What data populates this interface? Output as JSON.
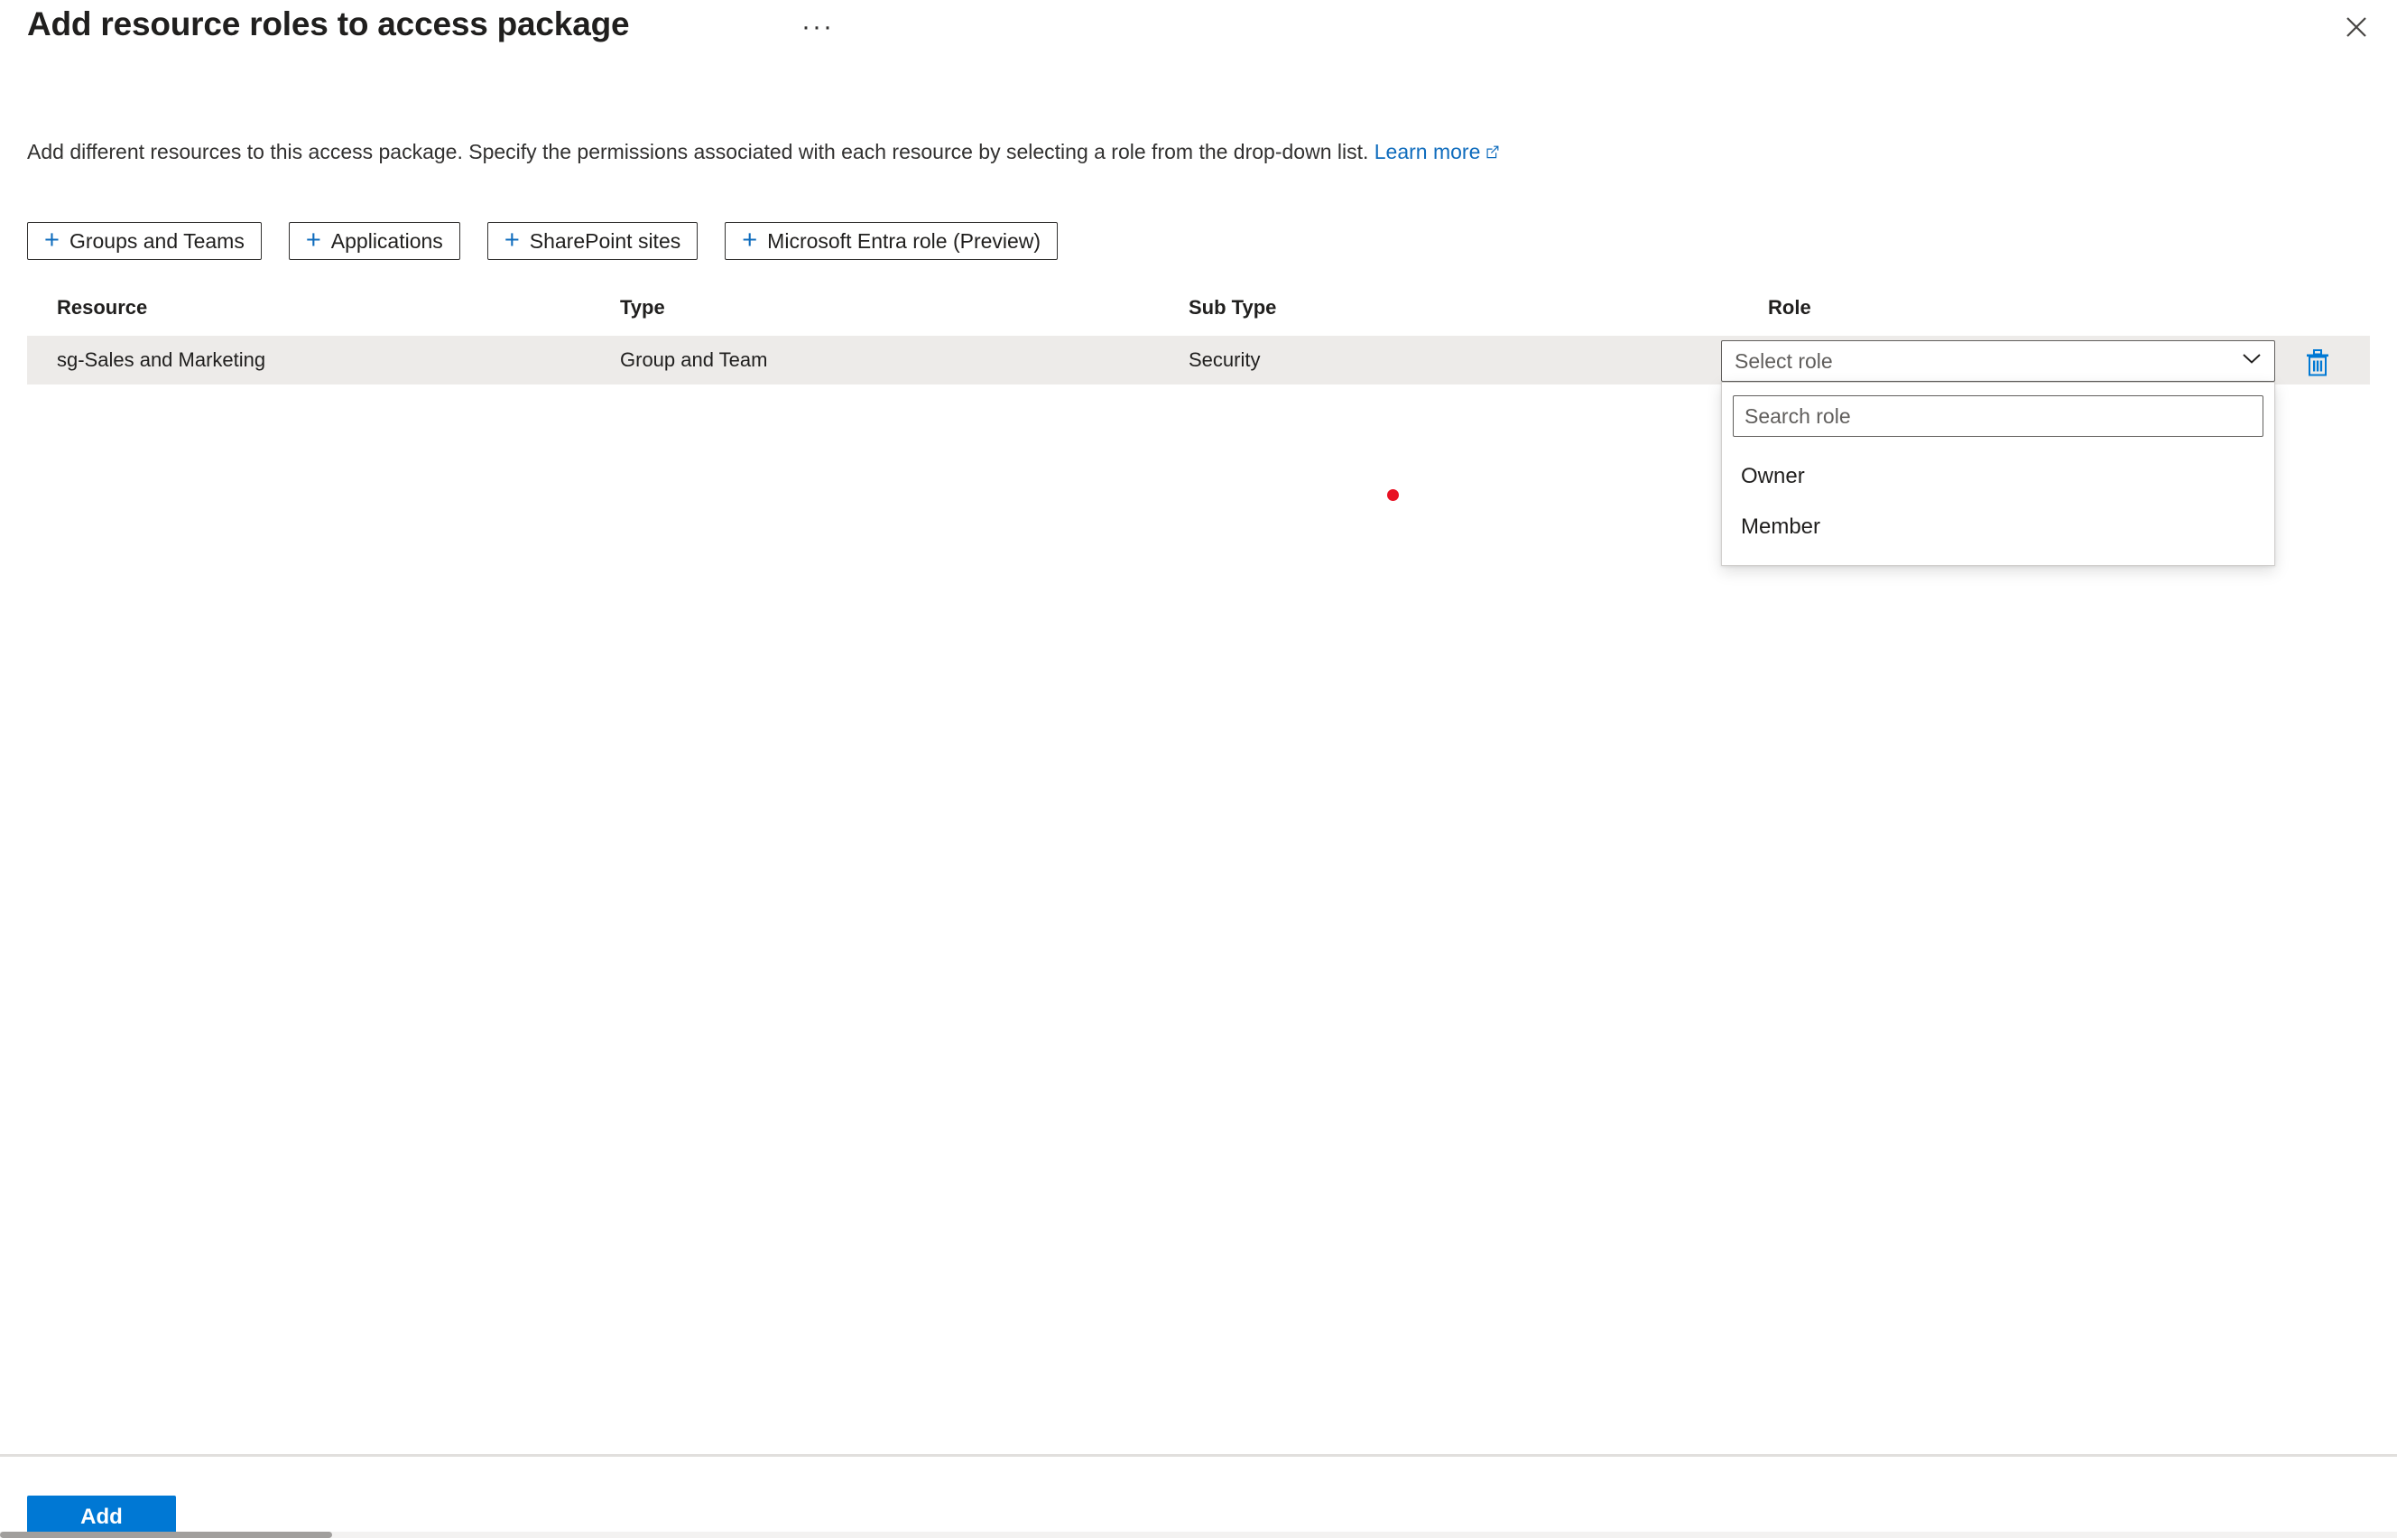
{
  "header": {
    "title": "Add resource roles to access package",
    "more_menu": "···",
    "close_label": "Close",
    "close_icon": "close-icon"
  },
  "description": {
    "text": "Add different resources to this access package. Specify the permissions associated with each resource by selecting a role from the drop-down list.",
    "link_label": "Learn more",
    "link_icon": "external-link-icon"
  },
  "command_bar": {
    "buttons": [
      {
        "label": "Groups and Teams",
        "icon": "plus-icon"
      },
      {
        "label": "Applications",
        "icon": "plus-icon"
      },
      {
        "label": "SharePoint sites",
        "icon": "plus-icon"
      },
      {
        "label": "Microsoft Entra role (Preview)",
        "icon": "plus-icon"
      }
    ]
  },
  "table": {
    "columns": [
      "Resource",
      "Type",
      "Sub Type",
      "Role"
    ],
    "rows": [
      {
        "resource": "sg-Sales and Marketing",
        "type": "Group and Team",
        "sub_type": "Security",
        "role_placeholder": "Select role",
        "delete_icon": "trash-icon",
        "chevron_icon": "chevron-down-icon"
      }
    ]
  },
  "role_dropdown": {
    "open": true,
    "search_placeholder": "Search role",
    "search_value": "",
    "options": [
      "Owner",
      "Member"
    ]
  },
  "footer": {
    "primary_button": "Add"
  },
  "colors": {
    "accent": "#0078d4",
    "link": "#0f6cbd",
    "row_selected_bg": "#edebe9",
    "text_primary": "#201f1e",
    "text_secondary": "#605e5c",
    "cursor_marker": "#e81123"
  }
}
